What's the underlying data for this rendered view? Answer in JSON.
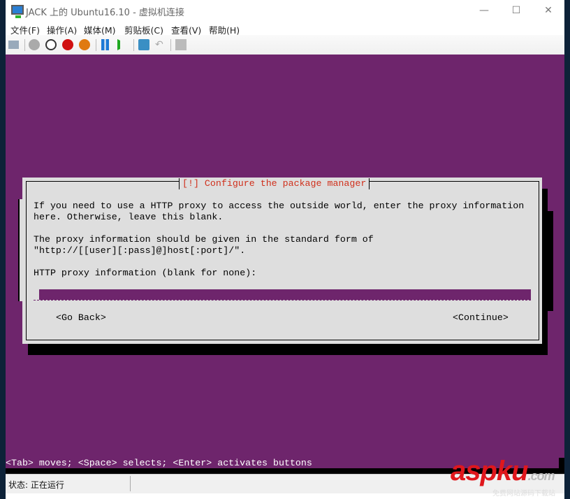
{
  "window": {
    "title": "JACK 上的 Ubuntu16.10 - 虚拟机连接",
    "minimize": "—",
    "maximize": "☐",
    "close": "✕"
  },
  "menu": [
    "文件(F)",
    "操作(A)",
    "媒体(M)",
    "剪贴板(C)",
    "查看(V)",
    "帮助(H)"
  ],
  "toolbar": {
    "icons": [
      "ctrl-alt-del-icon",
      "start-icon",
      "stop-icon",
      "shutdown-icon",
      "power-icon",
      "pause-icon",
      "resume-icon",
      "checkpoint-icon",
      "revert-icon",
      "enhanced-session-icon"
    ]
  },
  "dialog": {
    "title": "[!] Configure the package manager",
    "line1": "If you need to use a HTTP proxy to access the outside world, enter the proxy information",
    "line2": "here. Otherwise, leave this blank.",
    "line3": "The proxy information should be given in the standard form of",
    "line4": "\"http://[[user][:pass]@]host[:port]/\".",
    "prompt": "HTTP proxy information (blank for none):",
    "input_value": "",
    "go_back": "<Go Back>",
    "continue": "<Continue>"
  },
  "help_line": "<Tab> moves; <Space> selects; <Enter> activates buttons",
  "status": {
    "text": "状态: 正在运行"
  },
  "watermark": {
    "brand": "aspku",
    ".com": ".com",
    "sub": "免费网站源码下载站"
  }
}
